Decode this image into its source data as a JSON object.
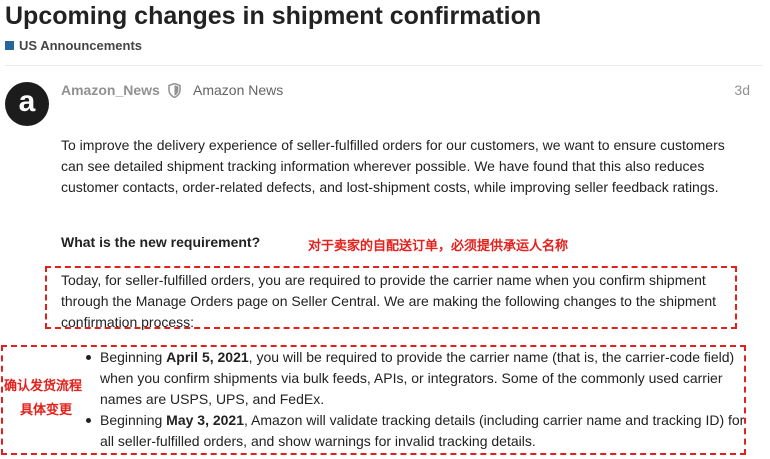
{
  "topic": {
    "title": "Upcoming changes in shipment confirmation",
    "category": "US Announcements"
  },
  "post": {
    "avatar_letter": "a",
    "username": "Amazon_News",
    "full_name": "Amazon News",
    "date": "3d",
    "intro": "To improve the delivery experience of seller-fulfilled orders for our customers, we want to ensure customers can see detailed shipment tracking information wherever possible. We have found that this also reduces customer contacts, order-related defects, and lost-shipment costs, while improving seller feedback ratings.",
    "heading": "What is the new requirement?",
    "today_paragraph": "Today, for seller-fulfilled orders, you are required to provide the carrier name when you confirm shipment through the Manage Orders page on Seller Central. We are making the following changes to the shipment confirmation process:",
    "bullets": [
      {
        "prefix": "Beginning ",
        "date": "April 5, 2021",
        "text": ", you will be required to provide the carrier name (that is, the carrier-code field) when you confirm shipments via bulk feeds, APIs, or integrators. Some of the commonly used carrier names are USPS, UPS, and FedEx."
      },
      {
        "prefix": "Beginning ",
        "date": "May 3, 2021",
        "text": ", Amazon will validate tracking details (including carrier name and tracking ID) for all seller-fulfilled orders, and show warnings for invalid tracking details."
      }
    ]
  },
  "annotations": {
    "heading_note": "对于卖家的自配送订单，必须提供承运人名称",
    "left_note_line1": "确认发货流程",
    "left_note_line2": "具体变更"
  },
  "colors": {
    "annotation_red": "#e3211c",
    "category_swatch": "#25669c",
    "avatar_bg": "#1c1c1c"
  }
}
